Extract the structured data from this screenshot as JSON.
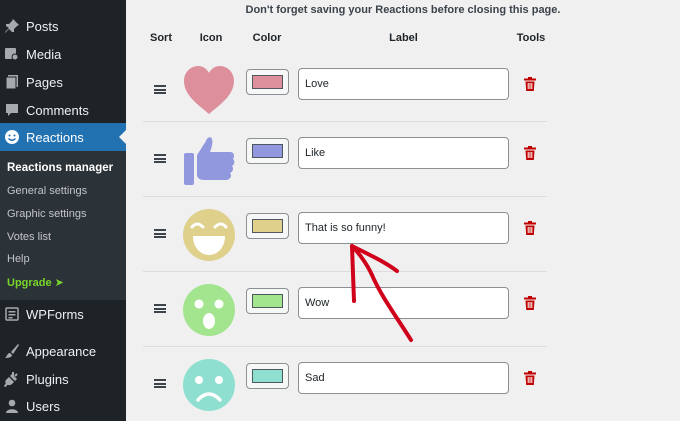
{
  "sidebar": {
    "items": [
      {
        "label": "Posts",
        "icon": "pushpin-icon"
      },
      {
        "label": "Media",
        "icon": "media-icon"
      },
      {
        "label": "Pages",
        "icon": "pages-icon"
      },
      {
        "label": "Comments",
        "icon": "comment-icon"
      },
      {
        "label": "Reactions",
        "icon": "smiley-icon"
      }
    ],
    "submenu": [
      "Reactions manager",
      "General settings",
      "Graphic settings",
      "Votes list",
      "Help",
      "Upgrade ➤"
    ],
    "bottom_items": [
      {
        "label": "WPForms",
        "icon": "wpforms-icon"
      },
      {
        "label": "Appearance",
        "icon": "brush-icon"
      },
      {
        "label": "Plugins",
        "icon": "plugin-icon"
      },
      {
        "label": "Users",
        "icon": "user-icon"
      }
    ]
  },
  "notice": "Don't forget saving your Reactions before closing this page.",
  "table": {
    "headers": {
      "sort": "Sort",
      "icon": "Icon",
      "color": "Color",
      "label": "Label",
      "tools": "Tools"
    },
    "rows": [
      {
        "icon": "heart-icon",
        "color": "#dd8f9b",
        "label": "Love"
      },
      {
        "icon": "thumbs-up-icon",
        "color": "#9198de",
        "label": "Like"
      },
      {
        "icon": "laughing-face-icon",
        "color": "#dfd08c",
        "label": "That is so funny!"
      },
      {
        "icon": "surprised-face-icon",
        "color": "#a2e58e",
        "label": "Wow"
      },
      {
        "icon": "sad-face-icon",
        "color": "#8fdfd0",
        "label": "Sad"
      }
    ]
  },
  "colors": {
    "sidebar_bg": "#1d2327",
    "active": "#2271b1",
    "trash": "#c00000",
    "annotation_arrow": "#d0021b"
  }
}
